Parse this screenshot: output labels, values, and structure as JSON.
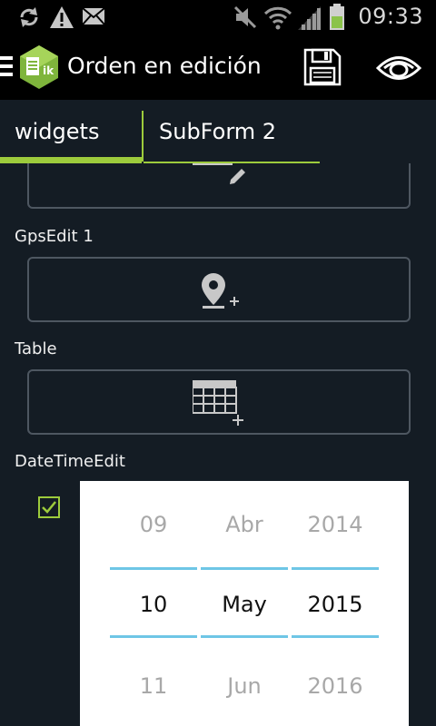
{
  "status_bar": {
    "time": "09:33",
    "icons": [
      "sync-icon",
      "warning-icon",
      "mail-icon",
      "mute-icon",
      "wifi-icon",
      "signal-icon",
      "battery-icon"
    ]
  },
  "action_bar": {
    "title": "Orden en edición",
    "icons": [
      "menu-icon",
      "app-logo",
      "save-icon",
      "eye-icon"
    ]
  },
  "tabs": [
    {
      "label": "widgets",
      "selected": true
    },
    {
      "label": "SubForm 2",
      "selected": false
    }
  ],
  "fields": [
    {
      "label": "GpsEdit 1",
      "icon": "location-add-icon"
    },
    {
      "label": "Table",
      "icon": "table-add-icon"
    },
    {
      "label": "DateTimeEdit",
      "icon": ""
    }
  ],
  "date_picker": {
    "checked": true,
    "day": {
      "prev": "09",
      "selected": "10",
      "next": "11"
    },
    "month": {
      "prev": "Abr",
      "selected": "May",
      "next": "Jun"
    },
    "year": {
      "prev": "2014",
      "selected": "2015",
      "next": "2016"
    }
  },
  "colors": {
    "accent": "#9dcb3c",
    "picker_line": "#6ec6e6",
    "background": "#141c24"
  }
}
